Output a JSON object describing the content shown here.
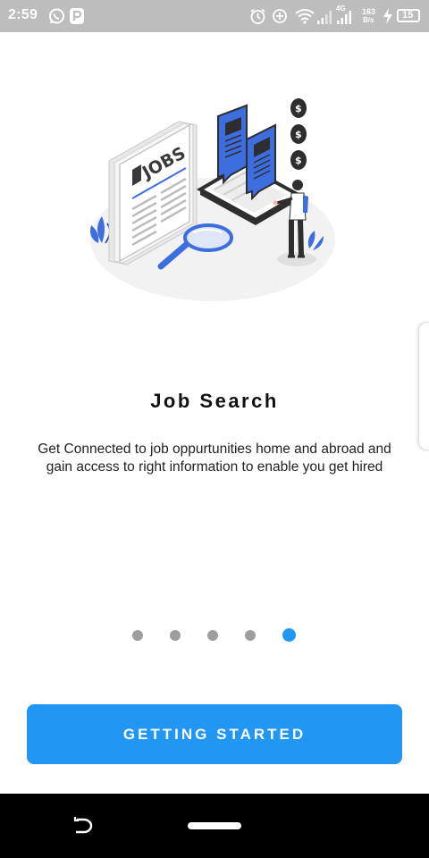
{
  "status_bar": {
    "time": "2:59",
    "network_label": "4G",
    "speed_value": "163",
    "speed_unit": "B/s",
    "battery": "15",
    "icons": [
      "whatsapp-icon",
      "p-app-icon",
      "alarm-icon",
      "data-saver-icon",
      "wifi-icon",
      "signal-icon",
      "signal-icon-2",
      "network-speed-icon",
      "charging-icon",
      "battery-icon"
    ]
  },
  "illustration": {
    "newspaper_text": "JOBS",
    "icons": [
      "newspaper-icon",
      "magnifier-icon",
      "laptop-icon",
      "resume-icon",
      "dollar-coin-icon",
      "person-icon",
      "plant-icon"
    ]
  },
  "onboarding": {
    "title": "Job Search",
    "description": "Get Connected to job oppurtunities home and abroad and gain access to right information to enable you get hired",
    "page_count": 5,
    "active_page": 5
  },
  "cta": {
    "label": "GETTING STARTED"
  },
  "colors": {
    "accent": "#2196f3",
    "status_bar": "#bdbdbd",
    "dot_inactive": "#9e9e9e",
    "nav_bar": "#000000"
  }
}
